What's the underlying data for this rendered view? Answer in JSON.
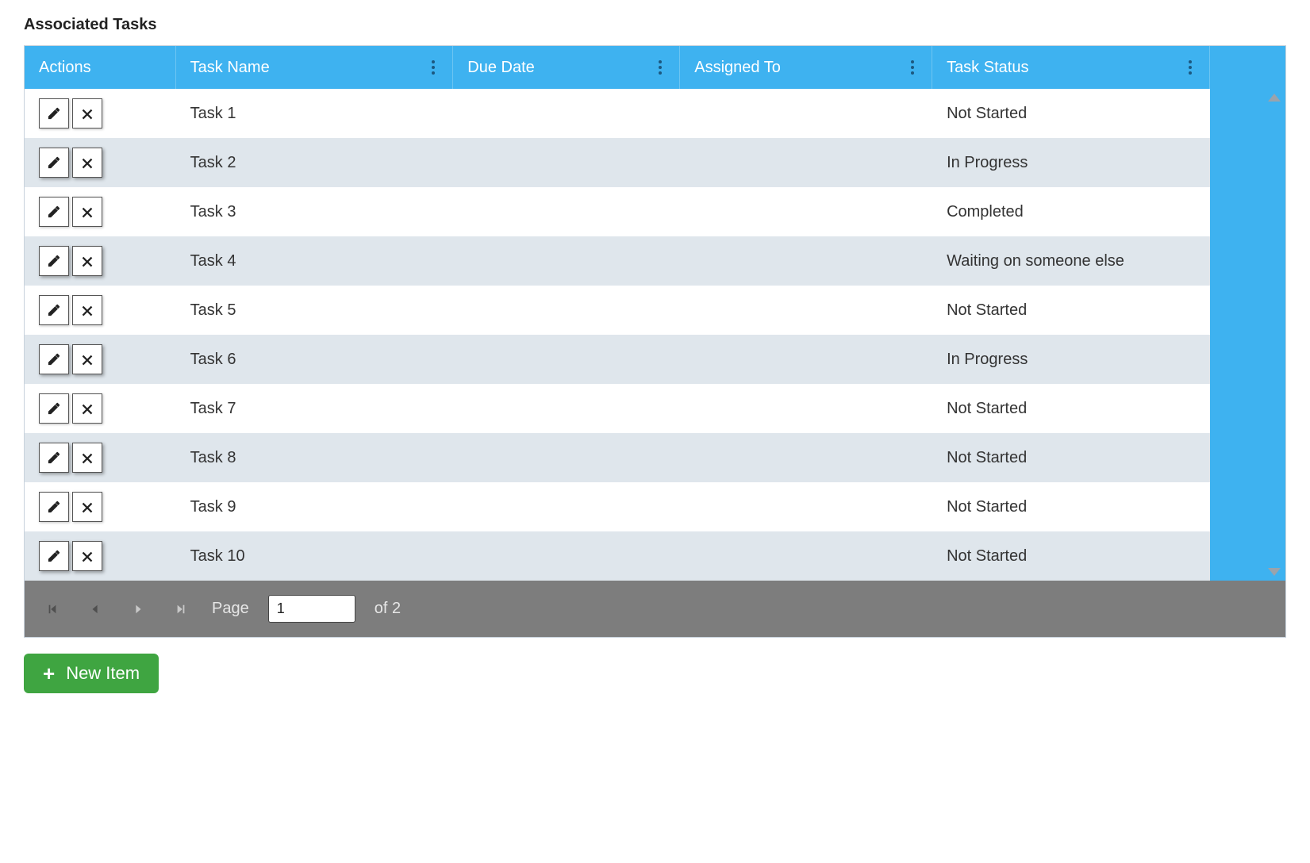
{
  "title": "Associated Tasks",
  "columns": {
    "actions": "Actions",
    "taskName": "Task Name",
    "dueDate": "Due Date",
    "assignedTo": "Assigned To",
    "taskStatus": "Task Status"
  },
  "rows": [
    {
      "taskName": "Task 1",
      "dueDate": "",
      "assignedTo": "",
      "taskStatus": "Not Started"
    },
    {
      "taskName": "Task 2",
      "dueDate": "",
      "assignedTo": "",
      "taskStatus": "In Progress"
    },
    {
      "taskName": "Task 3",
      "dueDate": "",
      "assignedTo": "",
      "taskStatus": "Completed"
    },
    {
      "taskName": "Task 4",
      "dueDate": "",
      "assignedTo": "",
      "taskStatus": "Waiting on someone else"
    },
    {
      "taskName": "Task 5",
      "dueDate": "",
      "assignedTo": "",
      "taskStatus": "Not Started"
    },
    {
      "taskName": "Task 6",
      "dueDate": "",
      "assignedTo": "",
      "taskStatus": "In Progress"
    },
    {
      "taskName": "Task 7",
      "dueDate": "",
      "assignedTo": "",
      "taskStatus": "Not Started"
    },
    {
      "taskName": "Task 8",
      "dueDate": "",
      "assignedTo": "",
      "taskStatus": "Not Started"
    },
    {
      "taskName": "Task 9",
      "dueDate": "",
      "assignedTo": "",
      "taskStatus": "Not Started"
    },
    {
      "taskName": "Task 10",
      "dueDate": "",
      "assignedTo": "",
      "taskStatus": "Not Started"
    }
  ],
  "pager": {
    "pageLabel": "Page",
    "current": "1",
    "ofLabel": "of 2"
  },
  "newItemLabel": "New Item"
}
